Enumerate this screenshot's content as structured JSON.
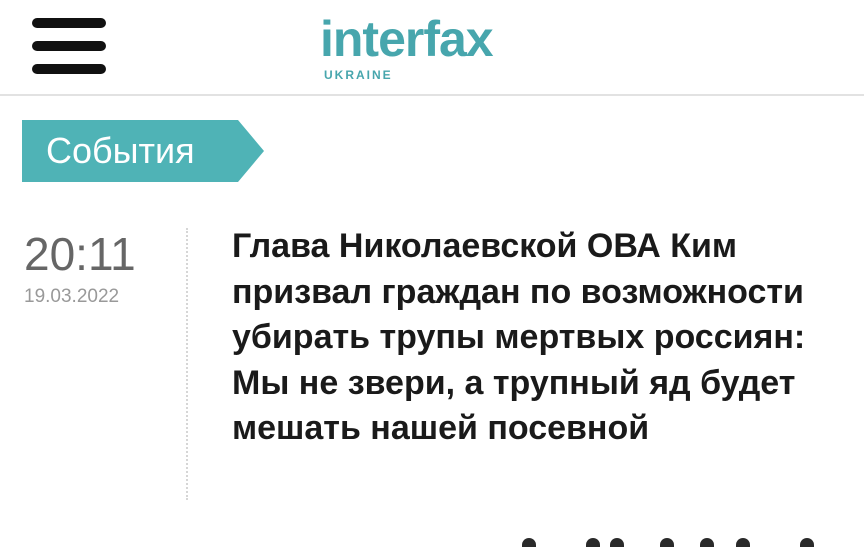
{
  "header": {
    "menu_icon": "hamburger-menu-icon",
    "logo": {
      "main": "interfax",
      "sub": "UKRAINE",
      "color": "#47a6ad"
    }
  },
  "category": {
    "label": "События",
    "color": "#4fb3b6"
  },
  "news": [
    {
      "time": "20:11",
      "date": "19.03.2022",
      "title": "Глава Николаевской ОВА Ким призвал граждан по возможности убирать трупы мертвых россиян: Мы не звери, а трупный яд будет мешать нашей посевной"
    }
  ]
}
